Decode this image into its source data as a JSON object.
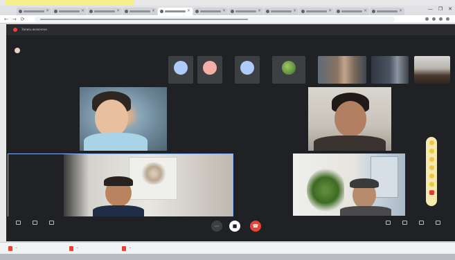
{
  "browser": {
    "tabs": [
      {
        "title": "",
        "active": false
      },
      {
        "title": "",
        "active": false
      },
      {
        "title": "",
        "active": false
      },
      {
        "title": "",
        "active": false
      },
      {
        "title": "",
        "active": true
      },
      {
        "title": "",
        "active": false
      },
      {
        "title": "",
        "active": false
      },
      {
        "title": "",
        "active": false
      },
      {
        "title": "",
        "active": false
      },
      {
        "title": "",
        "active": false
      },
      {
        "title": "",
        "active": false
      }
    ],
    "window_controls": [
      "—",
      "❐",
      "✕"
    ],
    "nav": [
      "←",
      "→",
      "⟳"
    ]
  },
  "meeting": {
    "banner": "Запись включена",
    "notice": "",
    "presenter_name": "",
    "presenter_sub": "",
    "top_right": "",
    "thumbnails": [
      {
        "caption": "",
        "initial": "",
        "color": "#aecbfa",
        "type": "avatar"
      },
      {
        "caption": "",
        "initial": "",
        "color": "#f6aea9",
        "type": "avatar"
      },
      {
        "caption": "",
        "initial": "",
        "color": "#aecbfa",
        "type": "avatar"
      },
      {
        "caption": "",
        "initial": "",
        "color": "#5a7d3a",
        "type": "photo"
      },
      {
        "caption": "",
        "initial": "",
        "color": "#8a7360",
        "type": "video"
      },
      {
        "caption": "",
        "initial": "",
        "color": "#4a5563",
        "type": "video"
      },
      {
        "caption": "",
        "initial": "",
        "color": "#6e6a66",
        "type": "video"
      }
    ],
    "tiles": [
      {
        "label": ""
      },
      {
        "label": ""
      },
      {
        "label": ""
      },
      {
        "label": ""
      }
    ],
    "toolbar_left": [
      {
        "label": ""
      },
      {
        "label": ""
      },
      {
        "label": ""
      }
    ],
    "toolbar_right": [
      {
        "label": ""
      },
      {
        "label": ""
      },
      {
        "label": ""
      },
      {
        "label": ""
      }
    ],
    "bottom_left": "",
    "bottom_right": "",
    "colors": {
      "end_call": "#ea4335",
      "bg": "#202124",
      "tile": "#3c4043"
    }
  },
  "downloads": [
    {
      "name": ""
    },
    {
      "name": ""
    },
    {
      "name": ""
    }
  ],
  "downloads_show_all": ""
}
